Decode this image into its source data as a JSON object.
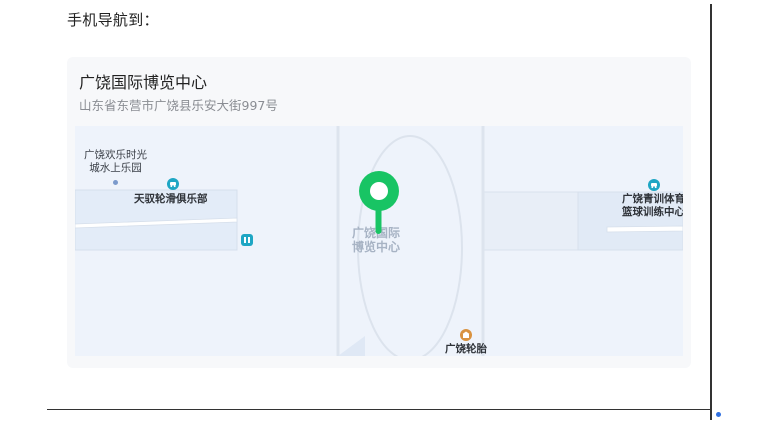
{
  "intro": "手机导航到：",
  "card": {
    "title": "广饶国际博览中心",
    "address": "山东省东营市广饶县乐安大街997号"
  },
  "map": {
    "labels": {
      "park_line1": "广饶欢乐时光",
      "park_line2": "城水上乐园",
      "skating_club": "天驭轮滑俱乐部",
      "expo_line1": "广饶国际",
      "expo_line2": "博览中心",
      "training_line1": "广饶青训体育",
      "training_line2": "篮球训练中心",
      "tire": "广饶轮胎"
    },
    "icons": {
      "skating": "car-icon",
      "training": "car-icon",
      "restroom": "restroom-icon",
      "tire": "shop-icon",
      "marker": "location-pin-icon"
    },
    "colors": {
      "marker": "#18c464",
      "poi_teal": "#1ea6c4",
      "poi_orange": "#d9923f",
      "map_bg": "#eef3fb"
    }
  }
}
